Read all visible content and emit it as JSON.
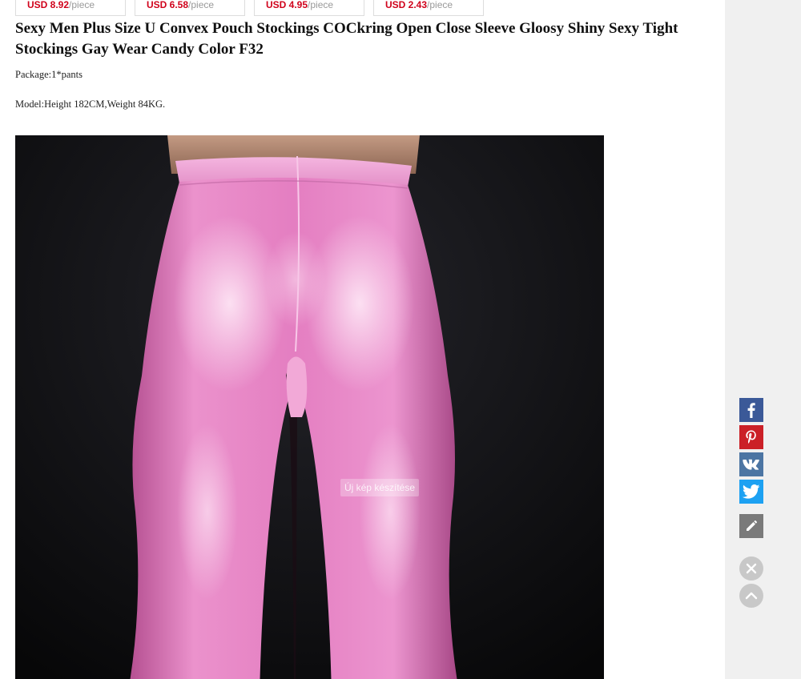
{
  "related_prices": [
    {
      "amount": "USD 8.92",
      "unit": "/piece"
    },
    {
      "amount": "USD 6.58",
      "unit": "/piece"
    },
    {
      "amount": "USD 4.95",
      "unit": "/piece"
    },
    {
      "amount": "USD 2.43",
      "unit": "/piece"
    }
  ],
  "product": {
    "title": "Sexy Men Plus Size U Convex Pouch Stockings COCkring Open Close Sleeve Gloosy Shiny Sexy Tight Stockings Gay Wear Candy Color F32",
    "package": "Package:1*pants",
    "model": "Model:Height 182CM,Weight 84KG."
  },
  "image_overlay": {
    "text": "Új kép készítése"
  },
  "share_bar": {
    "icons": [
      "facebook-icon",
      "pinterest-icon",
      "vk-icon",
      "twitter-icon",
      "pencil-icon"
    ],
    "colors": {
      "facebook": "#3b5998",
      "pinterest": "#cb2027",
      "vk": "#4c75a3",
      "twitter": "#1da1f2",
      "edit": "#7a7a7a"
    }
  },
  "controls": {
    "icons": [
      "close-icon",
      "chevron-up-icon"
    ]
  },
  "colors": {
    "price_red": "#d0021b",
    "rail_background": "#f0f0f0",
    "product_pink": "#e68ac8"
  }
}
